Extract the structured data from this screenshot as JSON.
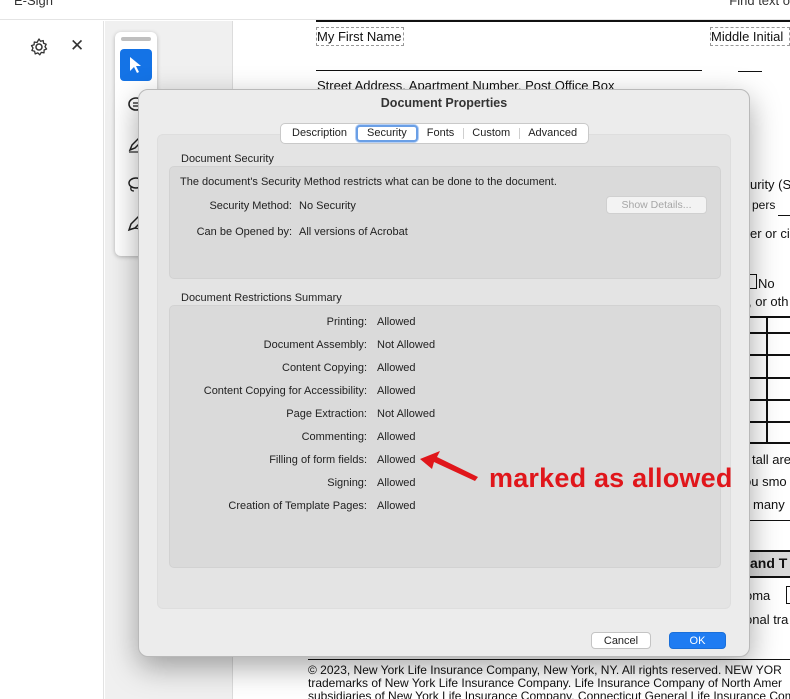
{
  "app": {
    "topbar_left": "E-Sign",
    "topbar_right": "Find text o"
  },
  "document": {
    "lines": [
      "My First Name",
      "Middle Initial",
      "Street Address, Apartment Number, Post Office Box",
      "urity (S",
      "pers",
      "er or ci",
      "No",
      ", or oth",
      "tall are",
      "ou smo",
      "many",
      "and T",
      "oma",
      "onal tra",
      "© 2023, New York Life Insurance Company, New York, NY. All rights reserved. NEW YOR",
      "trademarks of New York Life Insurance Company. Life Insurance Company of North Amer",
      "subsidiaries of New York Life Insurance Company. Connecticut General Life Insurance Compan"
    ]
  },
  "dialog": {
    "title": "Document Properties",
    "tabs": [
      "Description",
      "Security",
      "Fonts",
      "Custom",
      "Advanced"
    ],
    "active_tab": "Security",
    "security_section": {
      "heading": "Document Security",
      "intro": "The document's Security Method restricts what can be done to the document.",
      "method_label": "Security Method:",
      "method_value": "No Security",
      "opened_label": "Can be Opened by:",
      "opened_value": "All versions of Acrobat",
      "details_button": "Show Details..."
    },
    "restrictions_section": {
      "heading": "Document Restrictions Summary",
      "rows": [
        {
          "label": "Printing:",
          "value": "Allowed"
        },
        {
          "label": "Document Assembly:",
          "value": "Not Allowed"
        },
        {
          "label": "Content Copying:",
          "value": "Allowed"
        },
        {
          "label": "Content Copying for Accessibility:",
          "value": "Allowed"
        },
        {
          "label": "Page Extraction:",
          "value": "Not Allowed"
        },
        {
          "label": "Commenting:",
          "value": "Allowed"
        },
        {
          "label": "Filling of form fields:",
          "value": "Allowed"
        },
        {
          "label": "Signing:",
          "value": "Allowed"
        },
        {
          "label": "Creation of Template Pages:",
          "value": "Allowed"
        }
      ]
    },
    "buttons": {
      "cancel": "Cancel",
      "ok": "OK"
    }
  },
  "annotation": {
    "text": "marked as allowed",
    "color": "#e0161b"
  },
  "icons": [
    "gear-icon",
    "close-icon",
    "select-arrow-icon",
    "comment-icon",
    "pen-icon",
    "lasso-icon",
    "signature-icon"
  ],
  "colors": {
    "accent": "#1473e6",
    "ok_button": "#1f7cf2"
  }
}
